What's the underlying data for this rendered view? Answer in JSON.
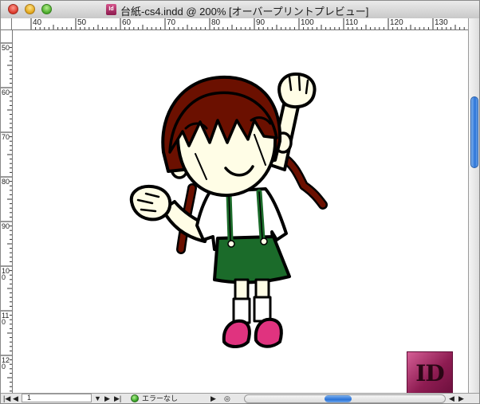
{
  "window": {
    "title": "台紙-cs4.indd @ 200% [オーバープリントプレビュー]"
  },
  "rulers": {
    "top": [
      "40",
      "50",
      "60",
      "70",
      "80",
      "90",
      "100",
      "110",
      "120",
      "130"
    ],
    "left": [
      "50",
      "60",
      "70",
      "80",
      "90",
      "100",
      "110",
      "120"
    ]
  },
  "document": {
    "logo_text": "ID"
  },
  "statusbar": {
    "page": "1",
    "preflight": "エラーなし"
  },
  "icons": [
    "close-icon",
    "minimize-icon",
    "zoom-icon",
    "document-icon",
    "status-ok-icon",
    "arrow-left-icon",
    "arrow-right-icon",
    "arrow-down-icon",
    "preflight-menu-icon"
  ]
}
